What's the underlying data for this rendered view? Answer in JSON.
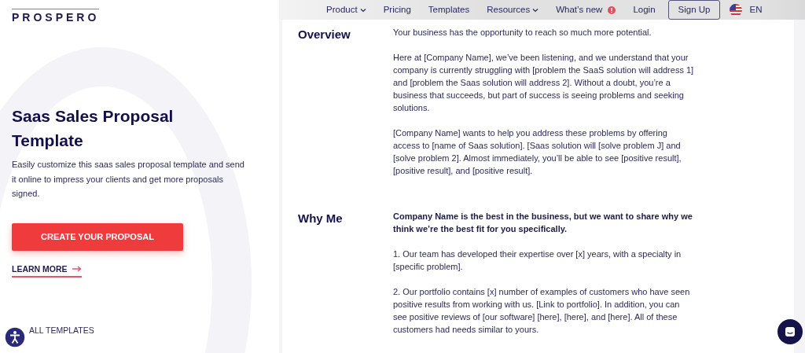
{
  "header": {
    "logo": "PROSPERO",
    "nav": [
      {
        "label": "Product",
        "dropdown": true,
        "badge": false
      },
      {
        "label": "Pricing",
        "dropdown": false,
        "badge": false
      },
      {
        "label": "Templates",
        "dropdown": false,
        "badge": false
      },
      {
        "label": "Resources",
        "dropdown": true,
        "badge": false
      },
      {
        "label": "What’s new",
        "dropdown": false,
        "badge": true
      },
      {
        "label": "Login",
        "dropdown": false,
        "badge": false
      }
    ],
    "signup": "Sign Up",
    "language": "EN"
  },
  "hero": {
    "title": "Saas Sales Proposal Template",
    "description": "Easily customize this saas sales proposal template and send it online to impress your clients and get more proposals signed.",
    "cta": "CREATE YOUR PROPOSAL",
    "learn_more": "LEARN MORE",
    "all_templates": "ALL TEMPLATES"
  },
  "document": {
    "sections": [
      {
        "heading": "Overview",
        "paragraphs": [
          {
            "kind": "text",
            "text": "Your business has the opportunity to reach so much more potential."
          },
          {
            "kind": "text",
            "text": "Here at [Company Name], we’ve been listening, and we understand that your company is currently struggling with [problem the SaaS solution will address 1] and [problem the Saas solution will address 2]. Without a doubt, you’re a business that succeeds, but part of success is seeing problems and seeking solutions."
          },
          {
            "kind": "text",
            "text": "[Company Name] wants to help you address these problems by offering access to [name of Saas solution]. [Saas solution will [solve problem J] and [solve problem 2]. Almost immediately, you’ll be able to see [positive result], [positive result], and [positive result]."
          }
        ]
      },
      {
        "heading": "Why Me",
        "paragraphs": [
          {
            "kind": "lead",
            "text": "Company Name is the best in the business, but we want to share why we think we’re the best fit for you specifically."
          },
          {
            "kind": "text",
            "text": "1. Our team has developed their expertise over [x] years, with a specialty in [specific problem]."
          },
          {
            "kind": "text",
            "text": "2. Our portfolio contains [x] number of examples of customers who have seen positive results from working with us. [Link to portfolio]. In addition, you can see positive reviews of [our software] [here], [here], and [here]. All of these customers had needs similar to yours."
          }
        ]
      }
    ]
  }
}
